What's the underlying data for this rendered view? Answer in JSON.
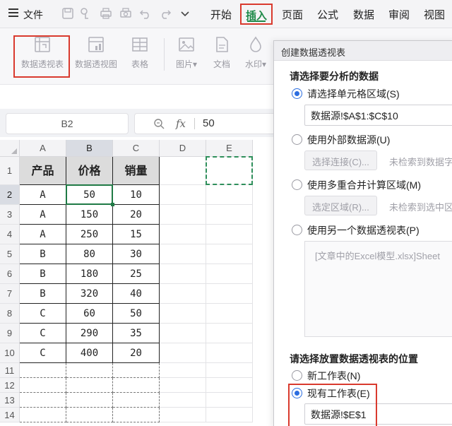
{
  "menubar": {
    "file_label": "文件",
    "tabs": [
      {
        "label": "开始"
      },
      {
        "label": "插入"
      },
      {
        "label": "页面"
      },
      {
        "label": "公式"
      },
      {
        "label": "数据"
      },
      {
        "label": "审阅"
      },
      {
        "label": "视图"
      }
    ],
    "active_tab": "插入",
    "quick_access_icons": [
      "save-icon",
      "format-painter-icon",
      "print-icon",
      "print-preview-icon",
      "undo-icon",
      "redo-icon",
      "more-chevron-icon"
    ]
  },
  "ribbon": {
    "items": [
      {
        "label": "数据透视表",
        "icon": "pivot-table-icon"
      },
      {
        "label": "数据透视图",
        "icon": "pivot-chart-icon"
      },
      {
        "label": "表格",
        "icon": "table-icon"
      },
      {
        "label": "图片",
        "icon": "picture-icon",
        "dropdown": "▾"
      },
      {
        "label": "文档",
        "icon": "document-icon"
      },
      {
        "label": "水印",
        "icon": "watermark-icon",
        "dropdown": "▾"
      }
    ]
  },
  "formula_bar": {
    "name_box": "B2",
    "fx_label": "fx",
    "value": "50"
  },
  "sheet": {
    "columns": [
      "A",
      "B",
      "C",
      "D",
      "E"
    ],
    "rows": [
      "1",
      "2",
      "3",
      "4",
      "5",
      "6",
      "7",
      "8",
      "9",
      "10",
      "11",
      "12",
      "13",
      "14"
    ],
    "header": [
      "产品",
      "价格",
      "销量"
    ],
    "data": [
      [
        "A",
        "50",
        "10"
      ],
      [
        "A",
        "150",
        "20"
      ],
      [
        "A",
        "250",
        "15"
      ],
      [
        "B",
        "80",
        "30"
      ],
      [
        "B",
        "180",
        "25"
      ],
      [
        "B",
        "320",
        "40"
      ],
      [
        "C",
        "60",
        "50"
      ],
      [
        "C",
        "290",
        "35"
      ],
      [
        "C",
        "400",
        "20"
      ]
    ],
    "active_cell": "B2"
  },
  "dialog": {
    "title": "创建数据透视表",
    "section1": "请选择要分析的数据",
    "opt_range": "请选择单元格区域(S)",
    "range_value": "数据源!$A$1:$C$10",
    "opt_external": "使用外部数据源(U)",
    "btn_connect": "选择连接(C)...",
    "hint_connect": "未检索到数据字",
    "opt_consolidate": "使用多重合并计算区域(M)",
    "btn_area": "选定区域(R)...",
    "hint_area": "未检索到选中区",
    "opt_other_pivot": "使用另一个数据透视表(P)",
    "other_pivot_text": "[文章中的Excel模型.xlsx]Sheet",
    "section2": "请选择放置数据透视表的位置",
    "opt_new_sheet": "新工作表(N)",
    "opt_existing_sheet": "现有工作表(E)",
    "existing_value": "数据源!$E$1"
  }
}
